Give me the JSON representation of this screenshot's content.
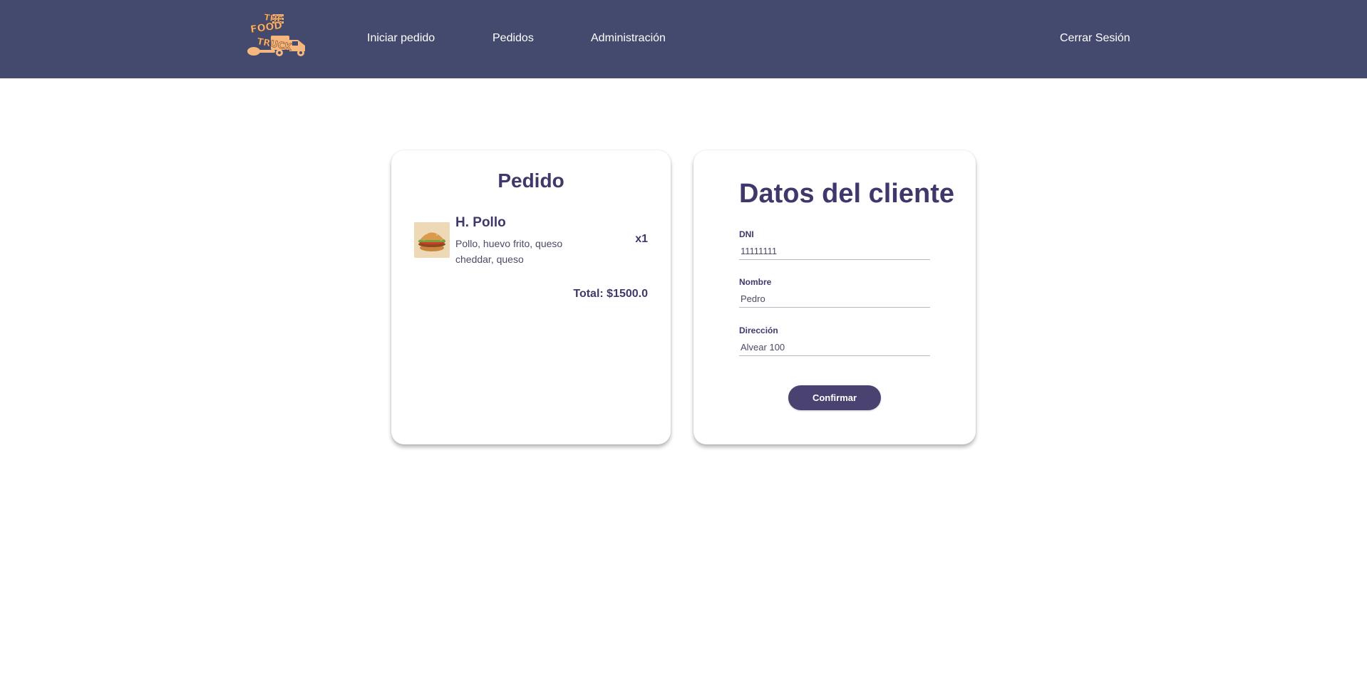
{
  "header": {
    "logo_alt": "THE FOOD TRUCK",
    "nav": [
      {
        "label": "Iniciar pedido"
      },
      {
        "label": "Pedidos"
      },
      {
        "label": "Administración"
      }
    ],
    "logout_label": "Cerrar Sesión"
  },
  "order": {
    "title": "Pedido",
    "items": [
      {
        "name": "H. Pollo",
        "description": "Pollo, huevo frito, queso cheddar, queso",
        "quantity": "x1",
        "image": "burger-image"
      }
    ],
    "total": "Total: $1500.0"
  },
  "client": {
    "title": "Datos del cliente",
    "fields": {
      "dni": {
        "label": "DNI",
        "value": "11111111"
      },
      "nombre": {
        "label": "Nombre",
        "value": "Pedro"
      },
      "direccion": {
        "label": "Dirección",
        "value": "Alvear 100"
      }
    },
    "confirm_label": "Confirmar"
  },
  "colors": {
    "header_bg": "#434a6e",
    "accent": "#40386a",
    "button_bg": "#4a4270",
    "logo": "#f5b77e"
  }
}
